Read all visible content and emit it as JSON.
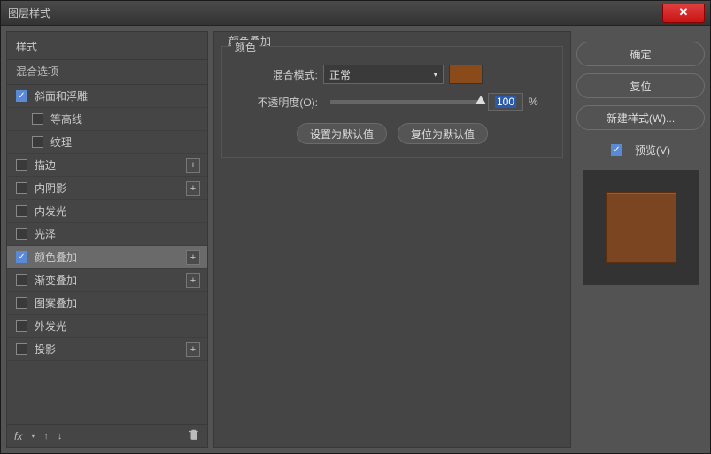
{
  "window": {
    "title": "图层样式"
  },
  "left": {
    "header": "样式",
    "sub": "混合选项",
    "items": [
      {
        "label": "斜面和浮雕",
        "checked": true,
        "plus": false,
        "indent": 0
      },
      {
        "label": "等高线",
        "checked": false,
        "plus": false,
        "indent": 1
      },
      {
        "label": "纹理",
        "checked": false,
        "plus": false,
        "indent": 1
      },
      {
        "label": "描边",
        "checked": false,
        "plus": true,
        "indent": 0
      },
      {
        "label": "内阴影",
        "checked": false,
        "plus": true,
        "indent": 0
      },
      {
        "label": "内发光",
        "checked": false,
        "plus": false,
        "indent": 0
      },
      {
        "label": "光泽",
        "checked": false,
        "plus": false,
        "indent": 0
      },
      {
        "label": "颜色叠加",
        "checked": true,
        "plus": true,
        "indent": 0,
        "selected": true
      },
      {
        "label": "渐变叠加",
        "checked": false,
        "plus": true,
        "indent": 0
      },
      {
        "label": "图案叠加",
        "checked": false,
        "plus": false,
        "indent": 0
      },
      {
        "label": "外发光",
        "checked": false,
        "plus": false,
        "indent": 0
      },
      {
        "label": "投影",
        "checked": false,
        "plus": true,
        "indent": 0
      }
    ],
    "footer": {
      "fx": "fx"
    }
  },
  "center": {
    "group_title": "颜色叠加",
    "inner_title": "颜色",
    "blend_label": "混合模式:",
    "blend_value": "正常",
    "swatch_color": "#8a4a1a",
    "opacity_label": "不透明度(O):",
    "opacity_value": "100",
    "opacity_suffix": "%",
    "btn_default": "设置为默认值",
    "btn_reset": "复位为默认值"
  },
  "right": {
    "ok": "确定",
    "cancel": "复位",
    "new_style": "新建样式(W)...",
    "preview_label": "预览(V)",
    "preview_checked": true
  }
}
